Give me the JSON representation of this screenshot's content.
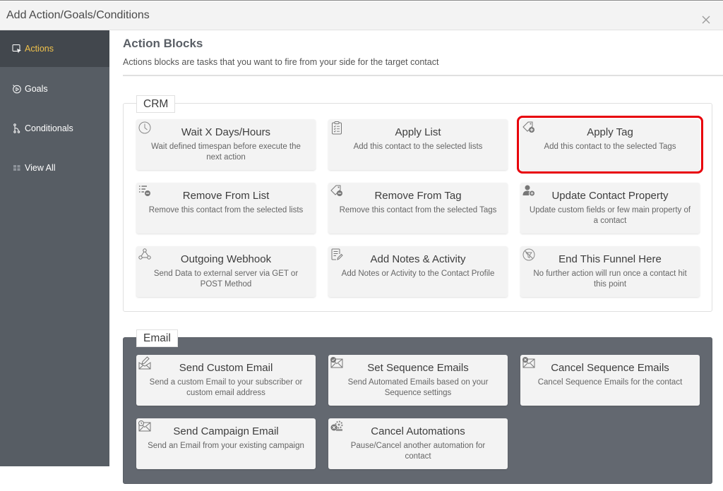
{
  "modal": {
    "title": "Add Action/Goals/Conditions",
    "close_icon": "close-icon"
  },
  "sidebar": {
    "items": [
      {
        "label": "Actions",
        "icon": "action-pointer-icon",
        "active": true
      },
      {
        "label": "Goals",
        "icon": "goal-target-icon",
        "active": false
      },
      {
        "label": "Conditionals",
        "icon": "conditional-branch-icon",
        "active": false
      },
      {
        "label": "View All",
        "icon": "grid-icon",
        "active": false
      }
    ]
  },
  "main": {
    "title": "Action Blocks",
    "description": "Actions blocks are tasks that you want to fire from your side for the target contact"
  },
  "sections": [
    {
      "legend": "CRM",
      "cards": [
        {
          "title": "Wait X Days/Hours",
          "desc": "Wait defined timespan before execute the next action",
          "icon": "clock-icon"
        },
        {
          "title": "Apply List",
          "desc": "Add this contact to the selected lists",
          "icon": "clipboard-list-icon"
        },
        {
          "title": "Apply Tag",
          "desc": "Add this contact to the selected Tags",
          "icon": "tag-add-icon",
          "highlighted": true
        },
        {
          "title": "Remove From List",
          "desc": "Remove this contact from the selected lists",
          "icon": "list-remove-icon"
        },
        {
          "title": "Remove From Tag",
          "desc": "Remove this contact from the selected Tags",
          "icon": "tag-remove-icon"
        },
        {
          "title": "Update Contact Property",
          "desc": "Update custom fields or few main property of a contact",
          "icon": "user-edit-icon"
        },
        {
          "title": "Outgoing Webhook",
          "desc": "Send Data to external server via GET or POST Method",
          "icon": "webhook-icon"
        },
        {
          "title": "Add Notes & Activity",
          "desc": "Add Notes or Activity to the Contact Profile",
          "icon": "note-edit-icon"
        },
        {
          "title": "End This Funnel Here",
          "desc": "No further action will run once a contact hit this point",
          "icon": "stop-funnel-icon"
        }
      ]
    },
    {
      "legend": "Email",
      "cards": [
        {
          "title": "Send Custom Email",
          "desc": "Send a custom Email to your subscriber or custom email address",
          "icon": "email-edit-icon"
        },
        {
          "title": "Set Sequence Emails",
          "desc": "Send Automated Emails based on your Sequence settings",
          "icon": "email-check-icon"
        },
        {
          "title": "Cancel Sequence Emails",
          "desc": "Cancel Sequence Emails for the contact",
          "icon": "email-cancel-icon"
        },
        {
          "title": "Send Campaign Email",
          "desc": "Send an Email from your existing campaign",
          "icon": "email-campaign-icon"
        },
        {
          "title": "Cancel Automations",
          "desc": "Pause/Cancel another automation for contact",
          "icon": "automation-cancel-icon"
        }
      ]
    }
  ],
  "colors": {
    "sidebar_bg": "#575d64",
    "sidebar_active_bg": "#42474d",
    "sidebar_active_text": "#f0c24b",
    "email_section_bg": "#636870",
    "card_bg": "#f3f3f3",
    "highlight": "#e8000b"
  }
}
